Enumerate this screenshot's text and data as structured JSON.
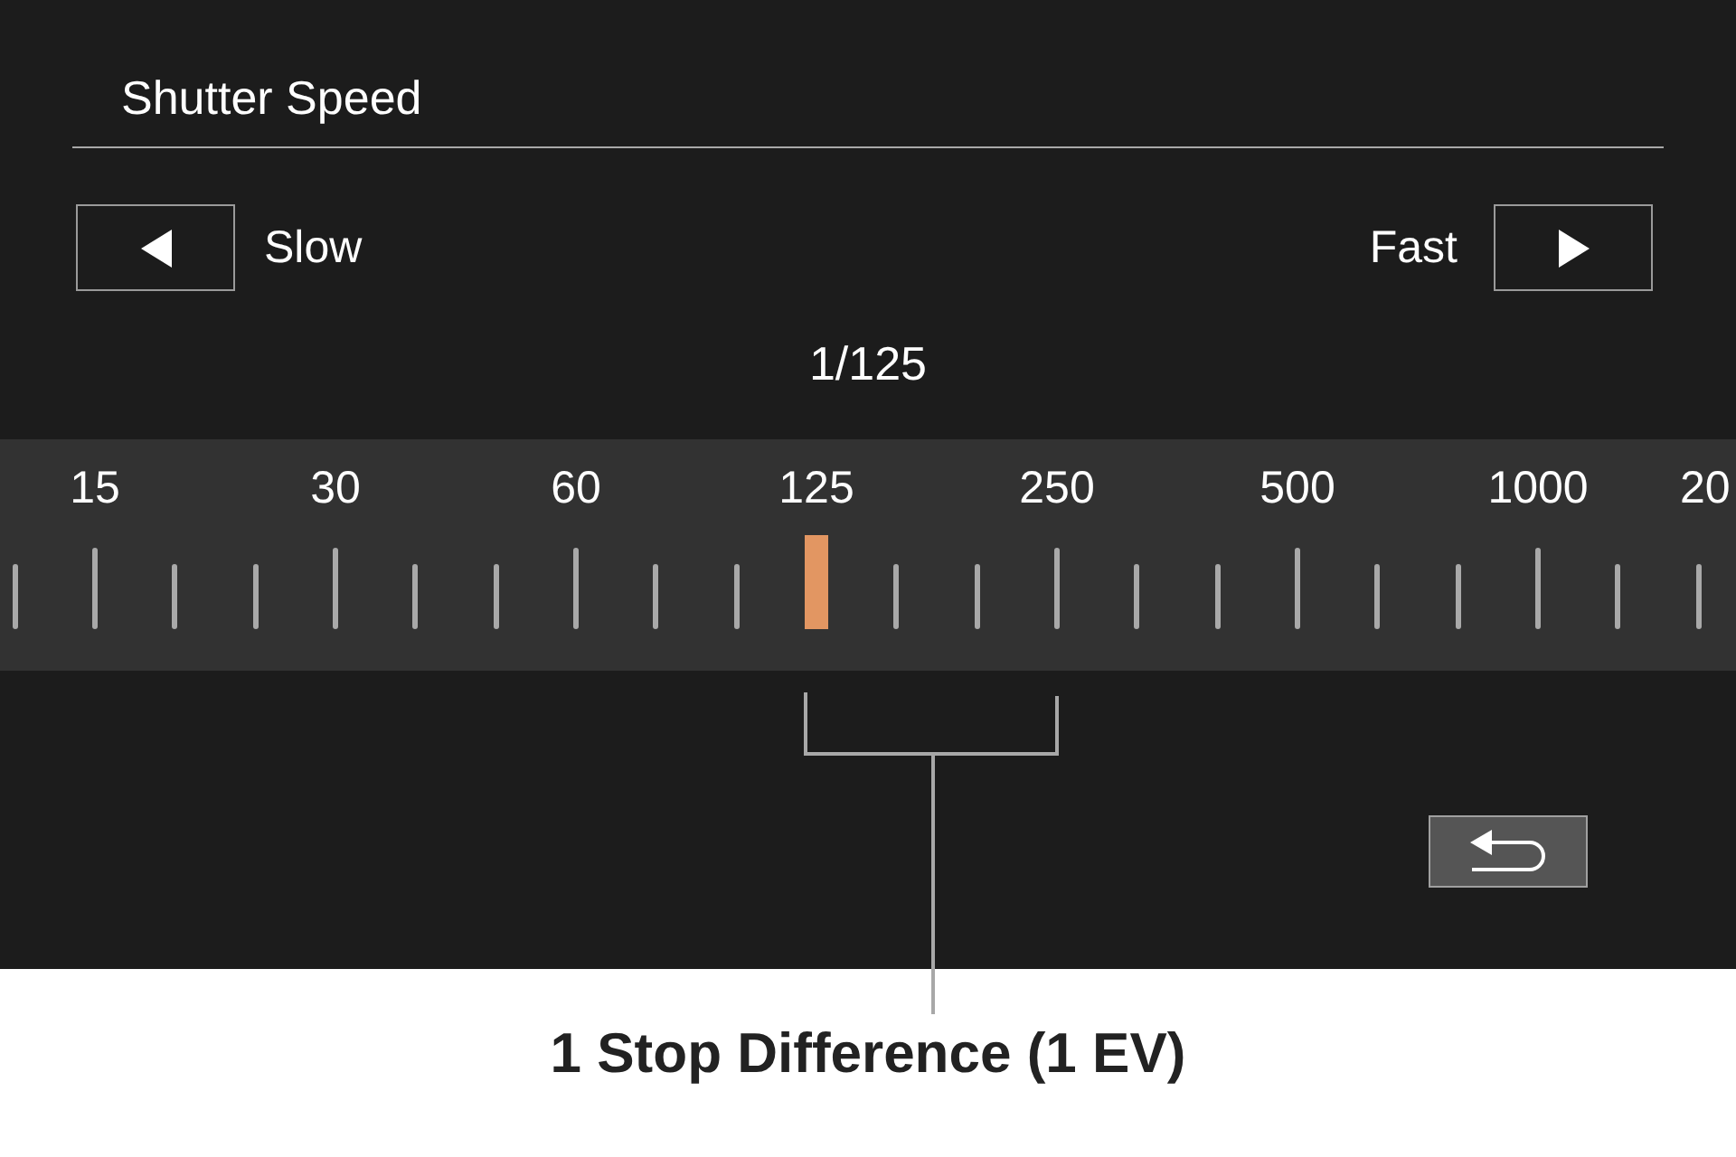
{
  "header": {
    "title": "Shutter Speed"
  },
  "direction_controls": [
    {
      "kind": "left",
      "label": "Slow"
    },
    {
      "kind": "right",
      "label": "Fast"
    }
  ],
  "current_value": "1/125",
  "scale": {
    "labels": [
      {
        "text": "15",
        "selected": false
      },
      {
        "text": "30",
        "selected": false
      },
      {
        "text": "60",
        "selected": false
      },
      {
        "text": "125",
        "selected": true
      },
      {
        "text": "250",
        "selected": false
      },
      {
        "text": "500",
        "selected": false
      },
      {
        "text": "1000",
        "selected": false
      },
      {
        "text": "20",
        "selected": false
      }
    ]
  },
  "annotation": {
    "caption": "1 Stop Difference (1 EV)"
  }
}
